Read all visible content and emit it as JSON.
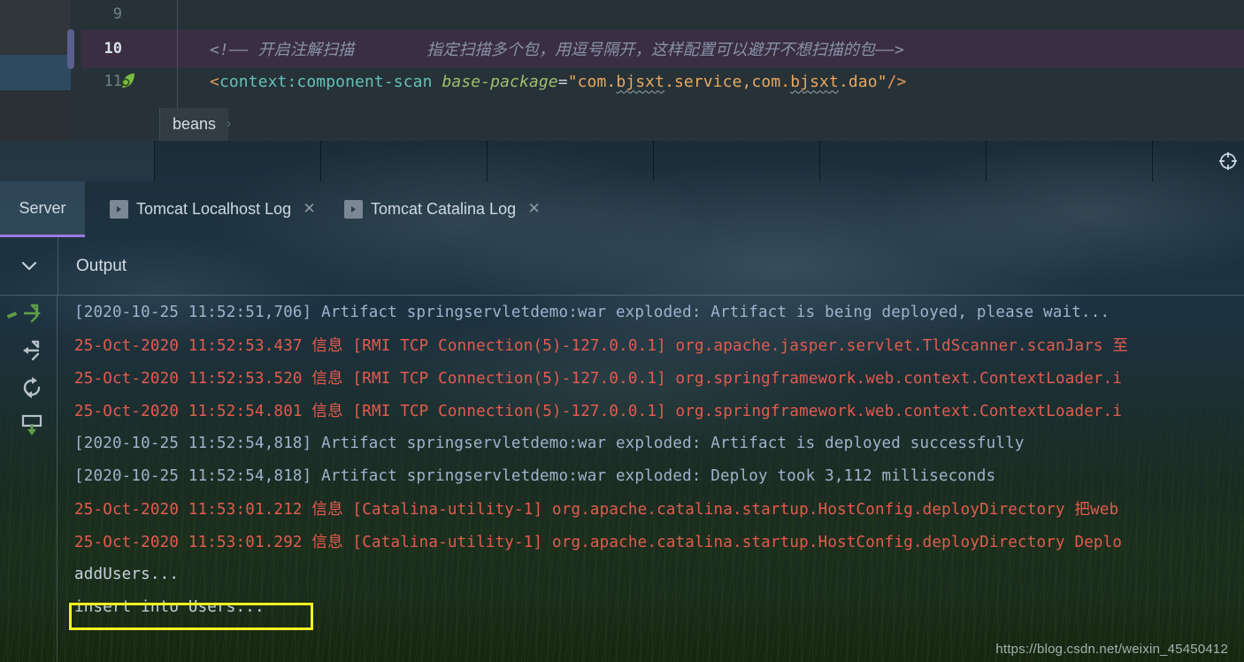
{
  "editor": {
    "lines": [
      {
        "number": "9",
        "type": "blank",
        "active": false
      },
      {
        "number": "10",
        "type": "comment",
        "active": true,
        "comment_open": "<!—— 开启注解扫描",
        "comment_rest": "指定扫描多个包，用逗号隔开，这样配置可以避开不想扫描的包——>"
      },
      {
        "number": "11",
        "type": "code",
        "active": false,
        "tag_open": "<",
        "tag_name": "context:component-scan",
        "attr_name": "base-package",
        "equals": "=",
        "quote_open": "\"",
        "value_part1": "com.",
        "value_squiggle1": "bjsxt",
        "value_part2": ".service,com.",
        "value_squiggle2": "bjsxt",
        "value_part3": ".dao",
        "quote_close": "\"",
        "tag_close": "/>",
        "icon": "spring-bean-icon"
      }
    ],
    "breadcrumb": {
      "label": "beans",
      "chevron": "›"
    }
  },
  "nav_band": {
    "segments": [
      "",
      "",
      "",
      "",
      "",
      "",
      ""
    ],
    "crosshair_icon": "crosshair-icon"
  },
  "toolwindow": {
    "tabs": [
      {
        "label": "Server",
        "selected": true,
        "has_run_icon": false,
        "closable": false
      },
      {
        "label": "Tomcat Localhost Log",
        "selected": false,
        "has_run_icon": true,
        "closable": true,
        "close_glyph": "✕"
      },
      {
        "label": "Tomcat Catalina Log",
        "selected": false,
        "has_run_icon": true,
        "closable": true,
        "close_glyph": "✕"
      }
    ],
    "output": {
      "label": "Output",
      "collapse_glyph": "⌄"
    },
    "gutter_icons": [
      {
        "name": "step-over-icon",
        "color": "#5f9e48"
      },
      {
        "name": "step-into-icon",
        "color": "#b6c1ca"
      },
      {
        "name": "rerun-icon",
        "color": "#b6c1ca"
      },
      {
        "name": "scroll-to-end-icon",
        "color": "#5f9e48"
      }
    ],
    "log_lines": [
      {
        "kind": "artifact",
        "text": "[2020-10-25 11:52:51,706] Artifact springservletdemo:war exploded: Artifact is being deployed, please wait..."
      },
      {
        "kind": "tomcat",
        "text": "25-Oct-2020 11:52:53.437 信息 [RMI TCP Connection(5)-127.0.0.1] org.apache.jasper.servlet.TldScanner.scanJars 至"
      },
      {
        "kind": "tomcat",
        "text": "25-Oct-2020 11:52:53.520 信息 [RMI TCP Connection(5)-127.0.0.1] org.springframework.web.context.ContextLoader.i"
      },
      {
        "kind": "tomcat",
        "text": "25-Oct-2020 11:52:54.801 信息 [RMI TCP Connection(5)-127.0.0.1] org.springframework.web.context.ContextLoader.i"
      },
      {
        "kind": "artifact",
        "text": "[2020-10-25 11:52:54,818] Artifact springservletdemo:war exploded: Artifact is deployed successfully"
      },
      {
        "kind": "artifact",
        "text": "[2020-10-25 11:52:54,818] Artifact springservletdemo:war exploded: Deploy took 3,112 milliseconds"
      },
      {
        "kind": "tomcat",
        "text": "25-Oct-2020 11:53:01.212 信息 [Catalina-utility-1] org.apache.catalina.startup.HostConfig.deployDirectory 把web"
      },
      {
        "kind": "tomcat",
        "text": "25-Oct-2020 11:53:01.292 信息 [Catalina-utility-1] org.apache.catalina.startup.HostConfig.deployDirectory Deplo"
      },
      {
        "kind": "plain",
        "text": "addUsers..."
      },
      {
        "kind": "plain",
        "text": "insert into Users..."
      }
    ],
    "annotation": {
      "name": "highlight-rect",
      "color": "#f5f222",
      "targets_line": "insert into Users..."
    }
  },
  "watermark": {
    "text": "https://blog.csdn.net/weixin_45450412"
  },
  "colors": {
    "accent_tab_underline": "#9a7ae0",
    "log_error_red": "#e35b4f",
    "log_info_blue": "#9fb3cc",
    "annotation_yellow": "#f5f222",
    "editor_bg": "#263238",
    "current_line": "#3a2e42"
  }
}
